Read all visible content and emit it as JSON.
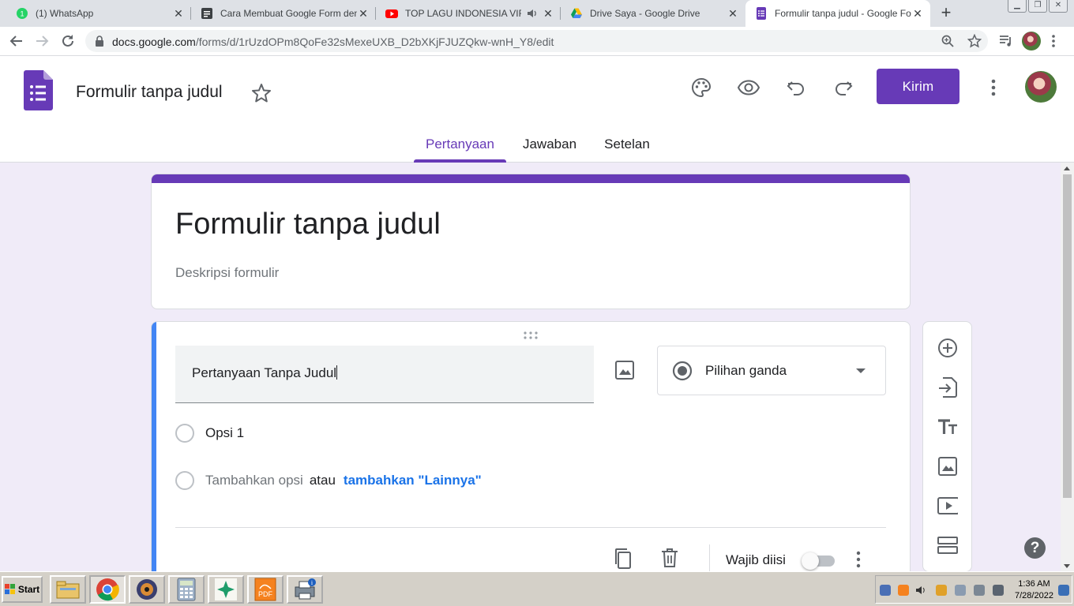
{
  "browser": {
    "tabs": [
      {
        "title": "(1) WhatsApp",
        "icon": "whatsapp-icon",
        "active": false
      },
      {
        "title": "Cara Membuat Google Form dengan",
        "icon": "docs-icon",
        "active": false
      },
      {
        "title": "TOP LAGU INDONESIA VIRAL S",
        "icon": "youtube-icon",
        "active": false,
        "audio": true
      },
      {
        "title": "Drive Saya - Google Drive",
        "icon": "drive-icon",
        "active": false
      },
      {
        "title": "Formulir tanpa judul - Google Forms",
        "icon": "forms-icon",
        "active": true
      }
    ],
    "new_tab": "+",
    "url_host": "docs.google.com",
    "url_path": "/forms/d/1rUzdOPm8QoFe32sMexeUXB_D2bXKjFJUZQkw-wnH_Y8/edit",
    "close_glyph": "✕"
  },
  "form_header": {
    "title": "Formulir tanpa judul",
    "send_label": "Kirim",
    "tabs": [
      "Pertanyaan",
      "Jawaban",
      "Setelan"
    ],
    "active_tab": "Pertanyaan"
  },
  "form": {
    "title": "Formulir tanpa judul",
    "description_placeholder": "Deskripsi formulir"
  },
  "question": {
    "title": "Pertanyaan Tanpa Judul",
    "type": "Pilihan ganda",
    "options": [
      "Opsi 1"
    ],
    "add_option": "Tambahkan opsi",
    "or": "atau",
    "add_other": "tambahkan \"Lainnya\"",
    "required_label": "Wajib diisi",
    "required": false
  },
  "help_glyph": "?",
  "taskbar": {
    "start_label": "Start",
    "clock_time": "1:36 AM",
    "clock_date": "7/28/2022"
  },
  "colors": {
    "accent": "#673ab7",
    "link": "#1a73e8",
    "focus": "#4285f4",
    "background": "#f0ebf8"
  }
}
